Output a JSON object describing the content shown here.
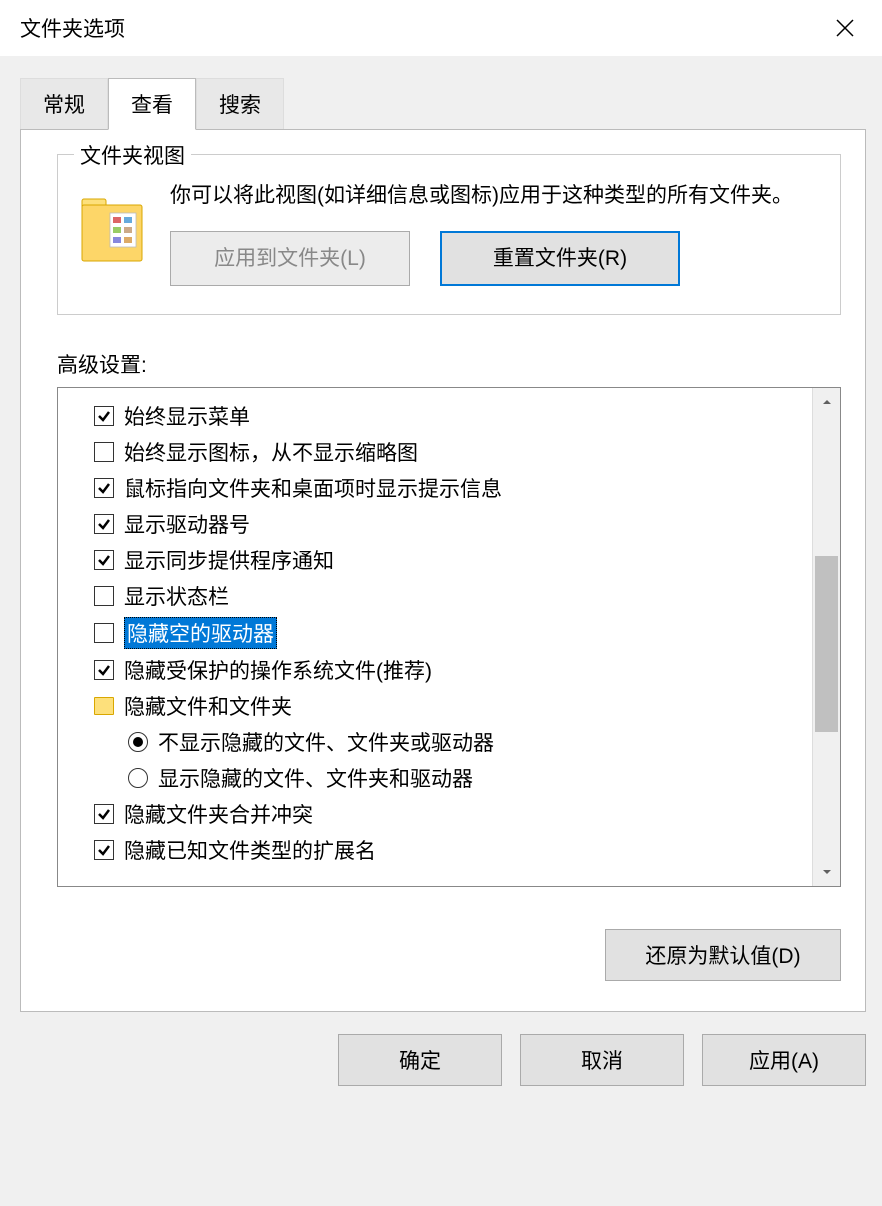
{
  "title": "文件夹选项",
  "tabs": {
    "general": "常规",
    "view": "查看",
    "search": "搜索"
  },
  "folderView": {
    "legend": "文件夹视图",
    "desc": "你可以将此视图(如详细信息或图标)应用于这种类型的所有文件夹。",
    "applyBtn": "应用到文件夹(L)",
    "resetBtn": "重置文件夹(R)"
  },
  "advanced": {
    "label": "高级设置:",
    "items": {
      "i0": "始终显示菜单",
      "i1": "始终显示图标，从不显示缩略图",
      "i2": "鼠标指向文件夹和桌面项时显示提示信息",
      "i3": "显示驱动器号",
      "i4": "显示同步提供程序通知",
      "i5": "显示状态栏",
      "i6": "隐藏空的驱动器",
      "i7": "隐藏受保护的操作系统文件(推荐)",
      "i8": "隐藏文件和文件夹",
      "i9": "不显示隐藏的文件、文件夹或驱动器",
      "i10": "显示隐藏的文件、文件夹和驱动器",
      "i11": "隐藏文件夹合并冲突",
      "i12": "隐藏已知文件类型的扩展名"
    }
  },
  "restoreBtn": "还原为默认值(D)",
  "buttons": {
    "ok": "确定",
    "cancel": "取消",
    "apply": "应用(A)"
  }
}
